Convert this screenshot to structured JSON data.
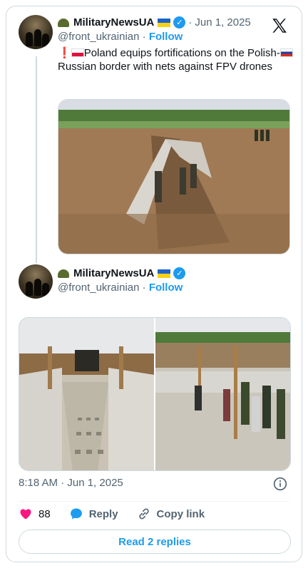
{
  "tweet1": {
    "display_name": "MilitaryNewsUA",
    "handle": "@front_ukrainian",
    "separator": "·",
    "date": "Jun 1, 2025",
    "follow_label": "Follow",
    "verified_mark": "✓",
    "text_part1": "Poland equips fortifications on the Polish-",
    "text_part2": "Russian border with nets against FPV drones"
  },
  "tweet2": {
    "display_name": "MilitaryNewsUA",
    "handle": "@front_ukrainian",
    "separator": "·",
    "follow_label": "Follow",
    "verified_mark": "✓"
  },
  "meta": {
    "timestamp": "8:18 AM · Jun 1, 2025"
  },
  "actions": {
    "like_count": "88",
    "reply_label": "Reply",
    "copy_link_label": "Copy link"
  },
  "read_replies_label": "Read 2 replies",
  "icons": {
    "brand": "x-logo-icon",
    "like": "heart-icon",
    "reply": "reply-bubble-icon",
    "copy": "link-icon",
    "info": "info-icon"
  },
  "colors": {
    "accent": "#1d9bf0",
    "like": "#f91880",
    "text": "#0f1419",
    "muted": "#536471",
    "border": "#cfd9de"
  }
}
